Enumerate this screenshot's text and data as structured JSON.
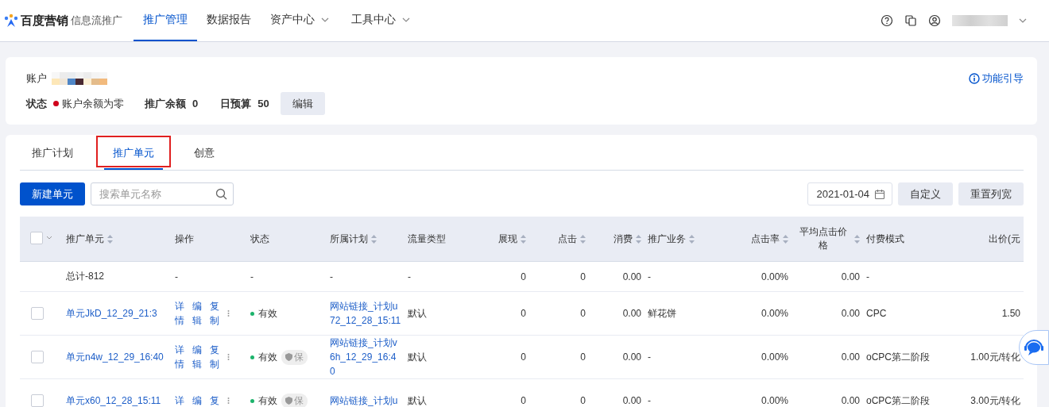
{
  "nav": {
    "brand": "百度营销",
    "product": "信息流推广",
    "items": [
      {
        "label": "推广管理",
        "selected": true,
        "dropdown": false
      },
      {
        "label": "数据报告",
        "selected": false,
        "dropdown": false
      },
      {
        "label": "资产中心",
        "selected": false,
        "dropdown": true
      },
      {
        "label": "工具中心",
        "selected": false,
        "dropdown": true
      }
    ]
  },
  "account": {
    "label": "账户",
    "status_label": "状态",
    "status": {
      "text": "账户余额为零",
      "color": "#d0021b"
    },
    "balance_label": "推广余额",
    "balance": "0",
    "budget_label": "日预算",
    "budget": "50",
    "edit_button": "编辑",
    "guide_link": "功能引导"
  },
  "tabs": [
    {
      "label": "推广计划",
      "selected": false,
      "highlighted": false
    },
    {
      "label": "推广单元",
      "selected": true,
      "highlighted": true
    },
    {
      "label": "创意",
      "selected": false,
      "highlighted": false
    }
  ],
  "toolbar": {
    "new_button": "新建单元",
    "search": {
      "placeholder": "搜索单元名称"
    },
    "date": "2021-01-04",
    "customize_button": "自定义",
    "reset_button": "重置列宽"
  },
  "table": {
    "select_all": {
      "checked": false
    },
    "columns": [
      {
        "label": "推广单元",
        "sortable": true
      },
      {
        "label": "操作",
        "sortable": false
      },
      {
        "label": "状态",
        "sortable": false
      },
      {
        "label": "所属计划",
        "sortable": true
      },
      {
        "label": "流量类型",
        "sortable": false
      },
      {
        "label": "展现",
        "sortable": true
      },
      {
        "label": "点击",
        "sortable": true
      },
      {
        "label": "消费",
        "sortable": true
      },
      {
        "label": "推广业务",
        "sortable": true
      },
      {
        "label": "点击率",
        "sortable": true
      },
      {
        "label": "平均点击价格",
        "sortable": true
      },
      {
        "label": "付费模式",
        "sortable": false
      },
      {
        "label": "出价(元",
        "sortable": false
      }
    ],
    "total": {
      "cells": [
        "总计-812",
        "-",
        "-",
        "-",
        "-",
        "0",
        "0",
        "0.00",
        "-",
        "0.00%",
        "0.00",
        "-"
      ]
    },
    "rows": [
      {
        "checked": false,
        "name": "单元JkD_12_29_21:3",
        "actions": [
          "详情",
          "编辑",
          "复制"
        ],
        "status": {
          "text": "有效",
          "color": "#1cb36b"
        },
        "protected": false,
        "plan": "网站链接_计划u72_12_28_15:11",
        "traffic": "默认",
        "impressions": "0",
        "clicks": "0",
        "cost": "0.00",
        "business": "鲜花饼",
        "ctr": "0.00%",
        "cpc": "0.00",
        "pay_mode": "CPC",
        "bid": "1.50"
      },
      {
        "checked": false,
        "name": "单元n4w_12_29_16:40",
        "actions": [
          "详情",
          "编辑",
          "复制"
        ],
        "status": {
          "text": "有效",
          "color": "#1cb36b"
        },
        "protected": true,
        "protect_label": "保",
        "plan": "网站链接_计划v6h_12_29_16:40",
        "traffic": "默认",
        "impressions": "0",
        "clicks": "0",
        "cost": "0.00",
        "business": "-",
        "ctr": "0.00%",
        "cpc": "0.00",
        "pay_mode": "oCPC第二阶段",
        "bid": "1.00元/转化"
      },
      {
        "checked": false,
        "name": "单元x60_12_28_15:11",
        "actions": [
          "详",
          "编",
          "复"
        ],
        "status": {
          "text": "有效",
          "color": "#1cb36b"
        },
        "protected": true,
        "protect_label": "保",
        "plan": "网站链接_计划u",
        "traffic": "默认",
        "impressions": "0",
        "clicks": "0",
        "cost": "0.00",
        "business": "-",
        "ctr": "0.00%",
        "cpc": "0.00",
        "pay_mode": "oCPC第二阶段",
        "bid": "3.00元/转化"
      }
    ]
  }
}
